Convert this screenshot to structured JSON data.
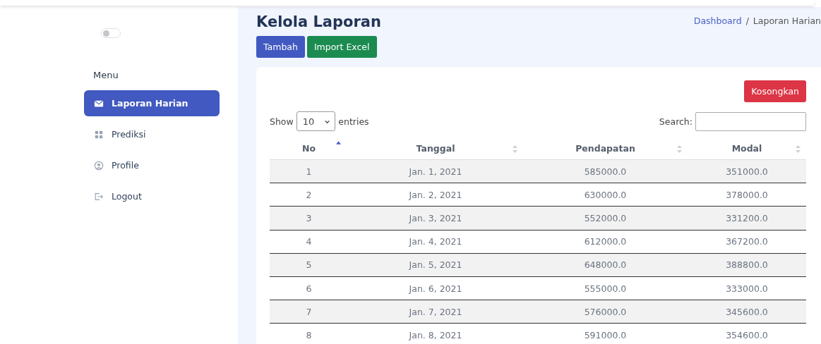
{
  "sidebar": {
    "theme_toggle": {
      "on": false
    },
    "heading": "Menu",
    "items": [
      {
        "label": "Laporan Harian",
        "selected": true
      },
      {
        "label": "Prediksi",
        "selected": false
      },
      {
        "label": "Profile",
        "selected": false
      },
      {
        "label": "Logout",
        "selected": false
      }
    ]
  },
  "page": {
    "title": "Kelola Laporan",
    "breadcrumb": [
      {
        "label": "Dashboard",
        "link": true
      },
      {
        "separator": "/",
        "label": "Laporan Harian",
        "link": false
      }
    ],
    "buttons": [
      {
        "label": "Tambah",
        "kind": "primary"
      },
      {
        "label": "Import Excel",
        "kind": "success"
      }
    ]
  },
  "card": {
    "clear_button": "Kosongkan",
    "length": {
      "show": "Show",
      "value": "10",
      "entries": "entries"
    },
    "search": {
      "label": "Search:"
    },
    "table": {
      "columns": [
        {
          "label": "No",
          "sorted": true
        },
        {
          "label": "Tanggal",
          "sorted": false
        },
        {
          "label": "Pendapatan",
          "sorted": false
        },
        {
          "label": "Modal",
          "sorted": false
        }
      ],
      "rows": [
        [
          "1",
          "Jan. 1, 2021",
          "585000.0",
          "351000.0"
        ],
        [
          "2",
          "Jan. 2, 2021",
          "630000.0",
          "378000.0"
        ],
        [
          "3",
          "Jan. 3, 2021",
          "552000.0",
          "331200.0"
        ],
        [
          "4",
          "Jan. 4, 2021",
          "612000.0",
          "367200.0"
        ],
        [
          "5",
          "Jan. 5, 2021",
          "648000.0",
          "388800.0"
        ],
        [
          "6",
          "Jan. 6, 2021",
          "555000.0",
          "333000.0"
        ],
        [
          "7",
          "Jan. 7, 2021",
          "576000.0",
          "345600.0"
        ],
        [
          "8",
          "Jan. 8, 2021",
          "591000.0",
          "354600.0"
        ]
      ]
    }
  }
}
